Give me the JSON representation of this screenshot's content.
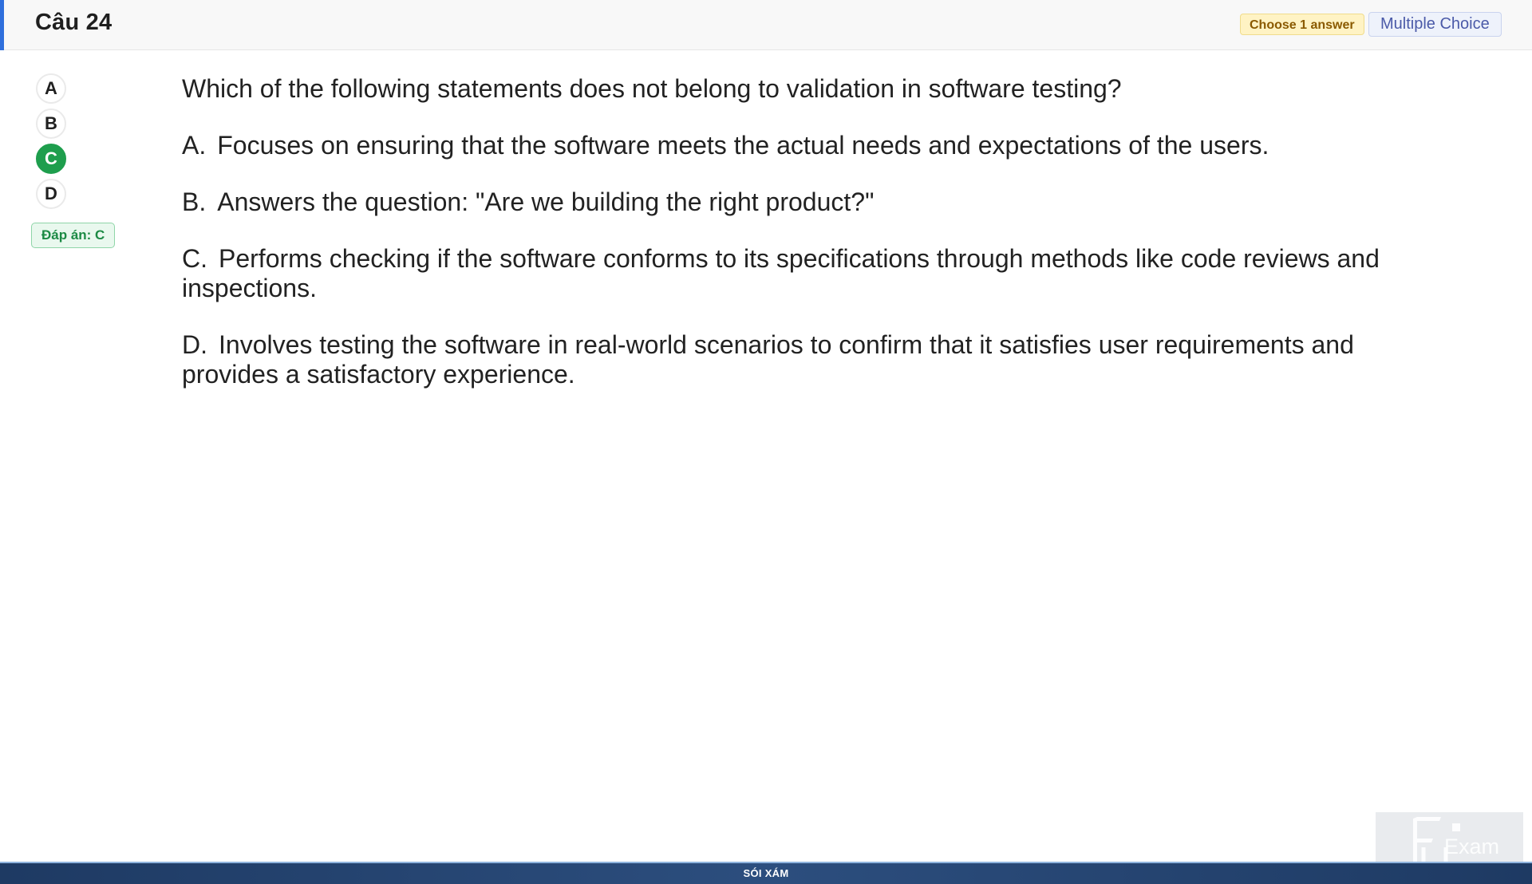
{
  "header": {
    "title": "Câu 24",
    "choose_badge": "Choose 1 answer",
    "type_badge": "Multiple Choice"
  },
  "options": [
    {
      "label": "A",
      "selected": false
    },
    {
      "label": "B",
      "selected": false
    },
    {
      "label": "C",
      "selected": true
    },
    {
      "label": "D",
      "selected": false
    }
  ],
  "answer_badge": "Đáp án: C",
  "question": {
    "text": "Which of the following statements does not belong to validation in software testing?",
    "choices": [
      {
        "letter": "A.",
        "text": "Focuses on ensuring that the software meets the actual needs and expectations of the users."
      },
      {
        "letter": "B.",
        "text": "Answers the question: \"Are we building the right product?\""
      },
      {
        "letter": "C.",
        "text": "Performs checking if the software conforms to its specifications through methods like code reviews and inspections."
      },
      {
        "letter": "D.",
        "text": "Involves testing the software in real-world scenarios to confirm that it satisfies user requirements and provides a satisfactory experience."
      }
    ]
  },
  "logo": {
    "text": "Exam"
  },
  "footer": {
    "text": "SÓI XÁM"
  },
  "colors": {
    "accent": "#2f6fdc",
    "selected_green": "#1e9e4d",
    "footer_blue": "#1e3a63"
  }
}
